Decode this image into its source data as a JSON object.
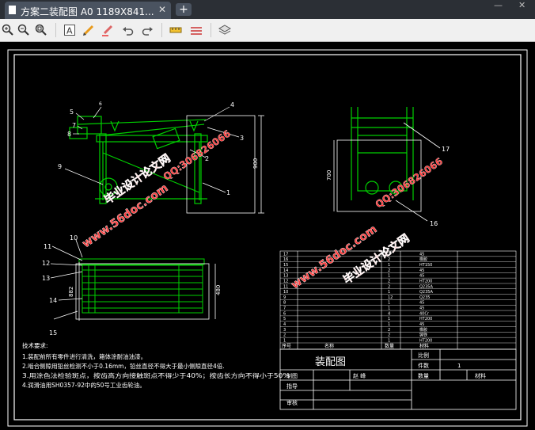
{
  "tab": {
    "title": "方案二装配图 A0 1189X841...",
    "close": "✕",
    "add": "+"
  },
  "window": {
    "minimize": "—",
    "close": "✕"
  },
  "toolbar": {
    "icons": [
      "zoom-in-icon",
      "zoom-out-icon",
      "zoom-fit-icon",
      "text-icon",
      "pencil-icon",
      "highlighter-icon",
      "undo-icon",
      "redo-icon",
      "measure-icon",
      "dimension-icon",
      "layers-icon"
    ]
  },
  "drawing": {
    "front_callouts": [
      "5",
      "6",
      "4",
      "7",
      "8",
      "3",
      "2",
      "9",
      "1"
    ],
    "front_dim": "900",
    "side_callouts": [
      "17",
      "16"
    ],
    "side_dim": "700",
    "plan_callouts": [
      "10",
      "11",
      "12",
      "13",
      "14",
      "15"
    ],
    "plan_dims": [
      "882",
      "480"
    ],
    "tech_title": "技术要求:",
    "tech_lines": [
      "1.装配前所有零件进行清洗，箱体涂耐油油漆。",
      "2.啮合侧隙用铅丝检测不小于0.16mm，铅丝直径不得大于最小侧隙直径4倍.",
      "3.用涂色法检验斑点，按齿高方向接触斑点不得少于40%；按齿长方向不得小于50%",
      "4.润滑油用SH0357-92中的50号工业齿轮油。"
    ],
    "bom_header": [
      "序号",
      "名称",
      "数量",
      "材料"
    ],
    "bom_rows": [
      [
        "17",
        "",
        "2",
        "45"
      ],
      [
        "16",
        "",
        "2",
        "橡胶"
      ],
      [
        "15",
        "",
        "1",
        "HT150"
      ],
      [
        "14",
        "",
        "2",
        "45"
      ],
      [
        "13",
        "",
        "1",
        "45"
      ],
      [
        "12",
        "",
        "2",
        "HT200"
      ],
      [
        "11",
        "",
        "2",
        "Q235A"
      ],
      [
        "10",
        "",
        "1",
        "Q235A"
      ],
      [
        "9",
        "",
        "12",
        "Q235"
      ],
      [
        "8",
        "",
        "1",
        "45"
      ],
      [
        "7",
        "",
        "1",
        "45"
      ],
      [
        "6",
        "",
        "4",
        "40Cr"
      ],
      [
        "5",
        "",
        "1",
        "HT200"
      ],
      [
        "4",
        "",
        "1",
        "45"
      ],
      [
        "3",
        "",
        "2",
        "橡胶"
      ],
      [
        "2",
        "",
        "2",
        "铸铁"
      ],
      [
        "1",
        "",
        "1",
        "HT200"
      ]
    ],
    "title_block": {
      "name": "装配图",
      "ratio_label": "比例",
      "pieces_label": "件数",
      "pieces_value": "1",
      "weight_label": "数量",
      "material_label": "材料",
      "drawn_label": "制图",
      "drawn_name": "赵 峰",
      "guide_label": "指导",
      "review_label": "审核"
    },
    "watermarks": [
      "毕业设计论文网",
      "QQ:306826066",
      "www.56doc.com"
    ]
  }
}
